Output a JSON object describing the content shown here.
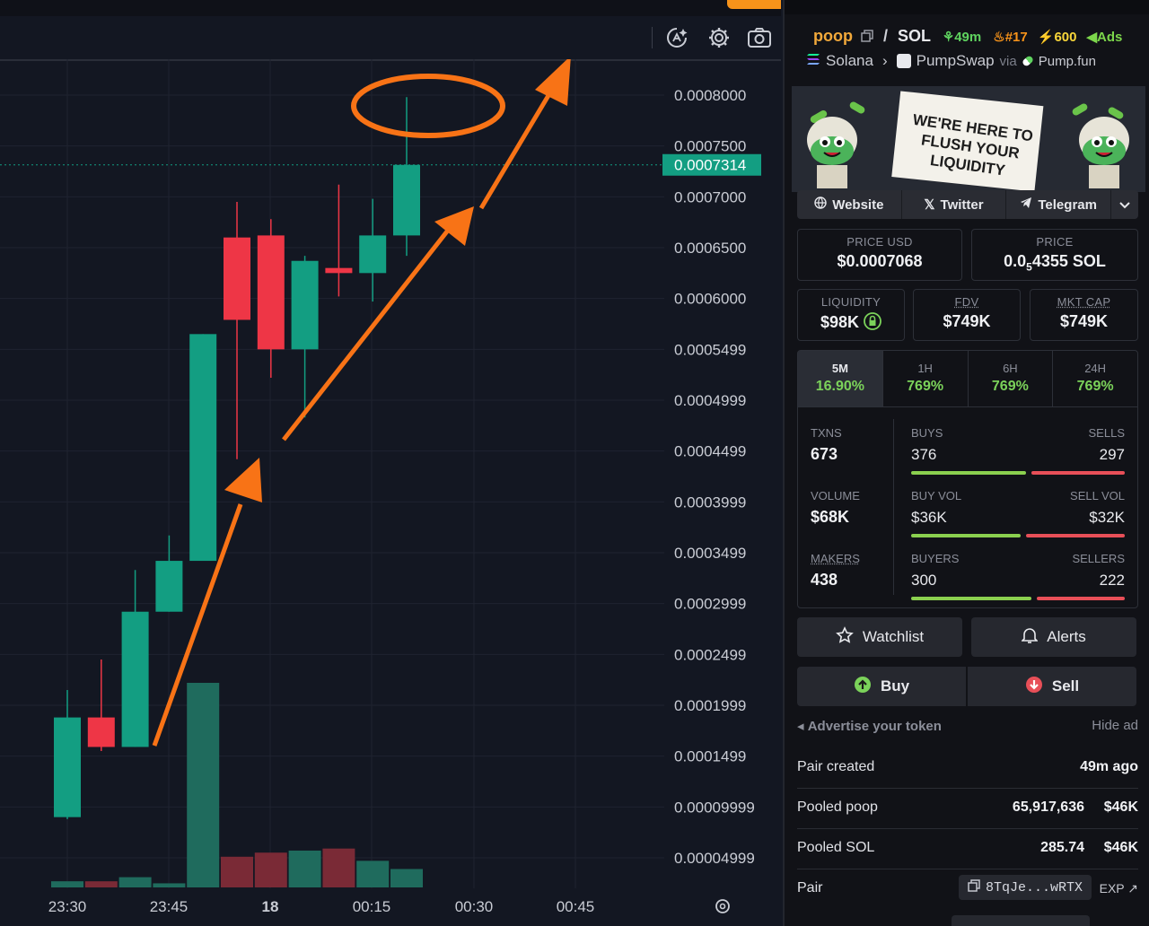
{
  "chart": {
    "price_axis": [
      "0.0008000",
      "0.0007500",
      "0.0007000",
      "0.0006500",
      "0.0006000",
      "0.0005499",
      "0.0004999",
      "0.0004499",
      "0.0003999",
      "0.0003499",
      "0.0002999",
      "0.0002499",
      "0.0001999",
      "0.0001499",
      "0.00009999",
      "0.00004999"
    ],
    "current_price_label": "0.0007314",
    "time_axis": [
      "23:30",
      "23:45",
      "18",
      "00:15",
      "00:30",
      "00:45"
    ],
    "colors": {
      "up": "#139e82",
      "down": "#ee3646",
      "annotation": "#f87316"
    },
    "icons": [
      "indicator-icon",
      "settings-icon",
      "camera-icon",
      "chart-settings-icon"
    ]
  },
  "chart_data": {
    "type": "candlestick",
    "x": [
      "23:30",
      "23:35",
      "23:40",
      "23:45",
      "23:50",
      "23:55",
      "00:00",
      "00:05",
      "00:10",
      "00:15",
      "00:20"
    ],
    "open": [
      9e-05,
      0.000188,
      0.000159,
      0.000292,
      0.000342,
      0.00066,
      0.000662,
      0.00055,
      0.00063,
      0.000625,
      0.000662
    ],
    "high": [
      0.000215,
      0.000245,
      0.000333,
      0.000367,
      0.000565,
      0.000695,
      0.000678,
      0.000642,
      0.000712,
      0.000698,
      0.000798
    ],
    "low": [
      8.8e-05,
      0.000155,
      0.000159,
      0.000292,
      0.000342,
      0.000442,
      0.000522,
      0.000483,
      0.000602,
      0.000597,
      0.000642
    ],
    "close": [
      0.000188,
      0.000159,
      0.000292,
      0.000342,
      0.000565,
      0.000579,
      0.00055,
      0.000637,
      0.000625,
      0.000662,
      0.0007314
    ],
    "volume_relative": [
      0.03,
      0.03,
      0.05,
      0.02,
      1.0,
      0.15,
      0.17,
      0.18,
      0.19,
      0.13,
      0.09
    ],
    "ylim": [
      0,
      0.00082
    ]
  },
  "pair": {
    "base": "poop",
    "sep": "/",
    "quote": "SOL",
    "age": "49m",
    "rank": "#17",
    "boost": "600",
    "ads": "Ads",
    "chain": "Solana",
    "dex": "PumpSwap",
    "via": "via",
    "launchpad": "Pump.fun"
  },
  "banner": {
    "text_lines": [
      "WE'RE HERE TO",
      "FLUSH YOUR",
      "LIQUIDITY"
    ]
  },
  "links": {
    "website": "Website",
    "twitter": "Twitter",
    "telegram": "Telegram"
  },
  "price": {
    "usd_label": "PRICE USD",
    "usd_value": "$0.0007068",
    "native_label": "PRICE",
    "native_prefix": "0.0",
    "native_sub": "5",
    "native_rest": "4355 SOL"
  },
  "metrics": {
    "liquidity_label": "LIQUIDITY",
    "liquidity_value": "$98K",
    "fdv_label": "FDV",
    "fdv_value": "$749K",
    "mcap_label": "MKT CAP",
    "mcap_value": "$749K"
  },
  "timeframes": [
    {
      "label": "5M",
      "change": "16.90%"
    },
    {
      "label": "1H",
      "change": "769%"
    },
    {
      "label": "6H",
      "change": "769%"
    },
    {
      "label": "24H",
      "change": "769%"
    }
  ],
  "txns": {
    "txns_label": "TXNS",
    "txns": "673",
    "buys_label": "BUYS",
    "buys": "376",
    "sells_label": "SELLS",
    "sells": "297",
    "volume_label": "VOLUME",
    "volume": "$68K",
    "buy_vol_label": "BUY VOL",
    "buy_vol": "$36K",
    "sell_vol_label": "SELL VOL",
    "sell_vol": "$32K",
    "makers_label": "MAKERS",
    "makers": "438",
    "buyers_label": "BUYERS",
    "buyers": "300",
    "sellers_label": "SELLERS",
    "sellers": "222"
  },
  "buttons": {
    "watchlist": "Watchlist",
    "alerts": "Alerts",
    "buy": "Buy",
    "sell": "Sell"
  },
  "advert": {
    "advertise": "Advertise your token",
    "hide": "Hide ad"
  },
  "info": {
    "pair_created_label": "Pair created",
    "pair_created": "49m ago",
    "pooled_base_label": "Pooled poop",
    "pooled_base_amount": "65,917,636",
    "pooled_base_usd": "$46K",
    "pooled_sol_label": "Pooled SOL",
    "pooled_sol_amount": "285.74",
    "pooled_sol_usd": "$46K",
    "pair_label": "Pair",
    "pair_address": "8TqJe...wRTX",
    "exp": "EXP"
  }
}
